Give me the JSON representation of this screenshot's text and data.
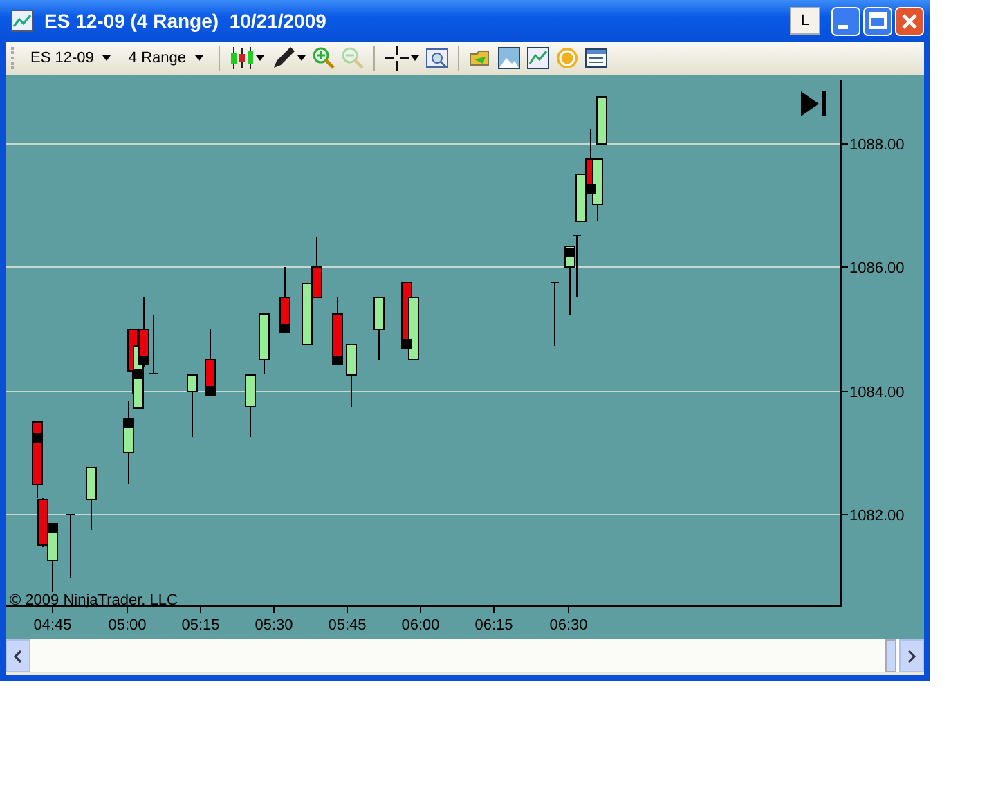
{
  "window": {
    "title": "ES 12-09 (4 Range)  10/21/2009",
    "layout_button": "L"
  },
  "toolbar": {
    "instrument": "ES 12-09",
    "period": "4 Range",
    "tools": [
      {
        "kind": "candles",
        "menu": true,
        "disabled": false
      },
      {
        "kind": "pen",
        "menu": true,
        "disabled": false
      },
      {
        "kind": "zoom-in",
        "disabled": false
      },
      {
        "kind": "zoom-out",
        "disabled": true
      },
      {
        "kind": "crosshair",
        "menu": true,
        "disabled": false
      },
      {
        "kind": "properties",
        "disabled": false
      },
      {
        "kind": "folder",
        "disabled": false
      },
      {
        "kind": "image",
        "disabled": false
      },
      {
        "kind": "chart",
        "disabled": false
      },
      {
        "kind": "coin",
        "disabled": false
      },
      {
        "kind": "list",
        "disabled": false
      }
    ]
  },
  "chart": {
    "y_labels": [
      "1088.00",
      "1086.00",
      "1084.00",
      "1082.00"
    ],
    "x_labels": [
      "04:45",
      "05:00",
      "05:15",
      "05:30",
      "05:45",
      "06:00",
      "06:15",
      "06:30"
    ],
    "copyright": "© 2009 NinjaTrader, LLC"
  }
}
